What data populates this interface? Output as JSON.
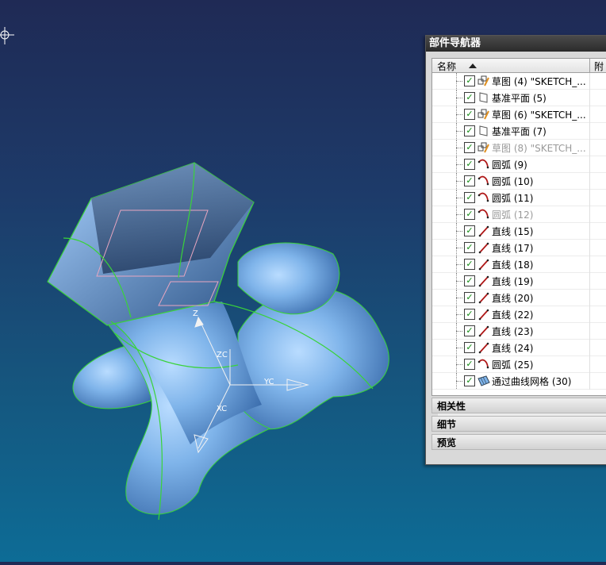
{
  "navigator": {
    "title": "部件导航器",
    "columns": {
      "name": "名称",
      "attach": "附"
    },
    "items": [
      {
        "label": "草图 (4) \"SKETCH_...",
        "icon": "sketch-icon",
        "dim": false
      },
      {
        "label": "基准平面 (5)",
        "icon": "datum-plane-icon",
        "dim": false
      },
      {
        "label": "草图 (6) \"SKETCH_...",
        "icon": "sketch-icon",
        "dim": false
      },
      {
        "label": "基准平面 (7)",
        "icon": "datum-plane-icon",
        "dim": false
      },
      {
        "label": "草图 (8) \"SKETCH_...",
        "icon": "sketch-icon",
        "dim": true
      },
      {
        "label": "圆弧 (9)",
        "icon": "arc-icon",
        "dim": false
      },
      {
        "label": "圆弧 (10)",
        "icon": "arc-icon",
        "dim": false
      },
      {
        "label": "圆弧 (11)",
        "icon": "arc-icon",
        "dim": false
      },
      {
        "label": "圆弧 (12)",
        "icon": "arc-icon",
        "dim": true
      },
      {
        "label": "直线 (15)",
        "icon": "line-icon",
        "dim": false
      },
      {
        "label": "直线 (17)",
        "icon": "line-icon",
        "dim": false
      },
      {
        "label": "直线 (18)",
        "icon": "line-icon",
        "dim": false
      },
      {
        "label": "直线 (19)",
        "icon": "line-icon",
        "dim": false
      },
      {
        "label": "直线 (20)",
        "icon": "line-icon",
        "dim": false
      },
      {
        "label": "直线 (22)",
        "icon": "line-icon",
        "dim": false
      },
      {
        "label": "直线 (23)",
        "icon": "line-icon",
        "dim": false
      },
      {
        "label": "直线 (24)",
        "icon": "line-icon",
        "dim": false
      },
      {
        "label": "圆弧 (25)",
        "icon": "arc-icon",
        "dim": false
      },
      {
        "label": "通过曲线网格 (30)",
        "icon": "mesh-surface-icon",
        "dim": false
      }
    ],
    "sections": {
      "dependencies": "相关性",
      "details": "细节",
      "preview": "预览"
    }
  },
  "axes": {
    "z": "Z",
    "zc": "ZC",
    "yc": "YC",
    "xc": "XC"
  },
  "colors": {
    "model_fill": "#7db3ea",
    "edge_green": "#33e033",
    "background_top": "#1f2a55",
    "background_bottom": "#0d6c96"
  }
}
